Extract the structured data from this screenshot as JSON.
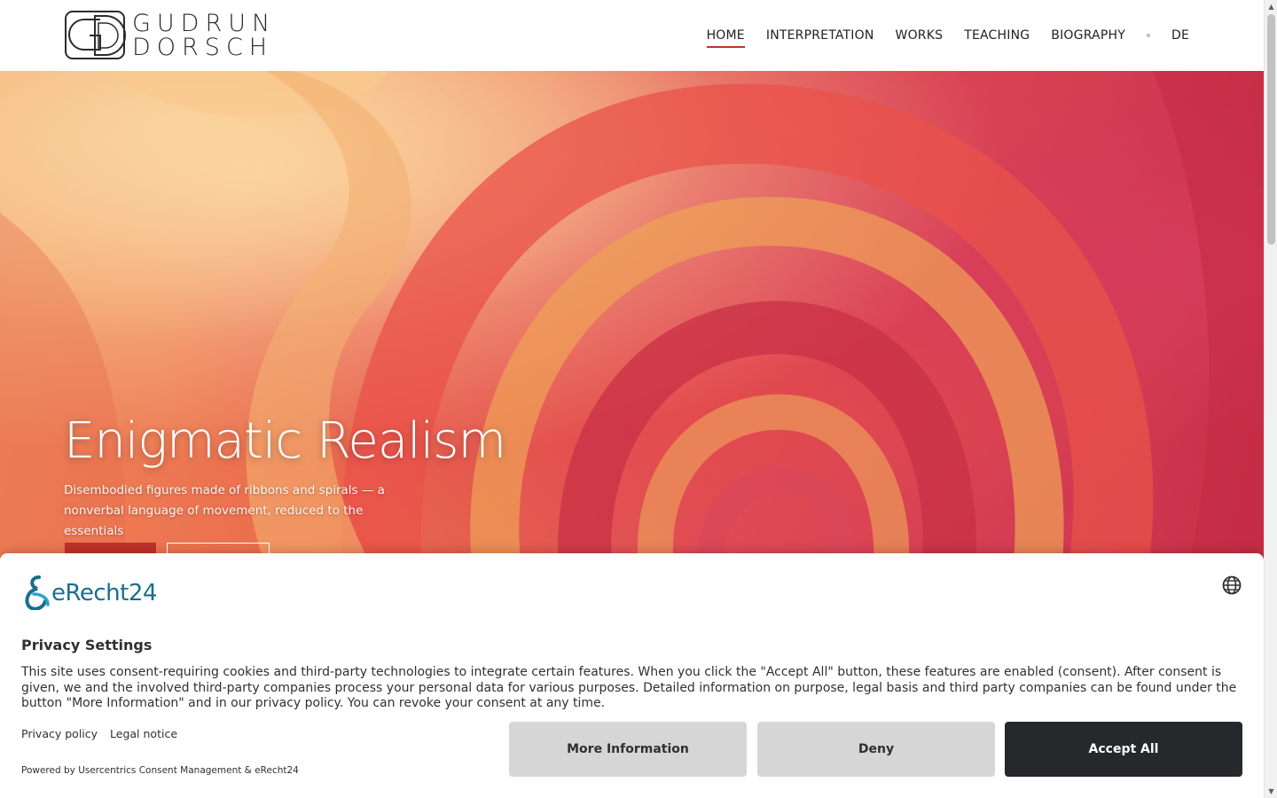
{
  "header": {
    "logo_line1": "GUDRUN",
    "logo_line2": "DORSCH",
    "nav": [
      {
        "label": "HOME",
        "active": true
      },
      {
        "label": "INTERPRETATION"
      },
      {
        "label": "WORKS"
      },
      {
        "label": "TEACHING"
      },
      {
        "label": "BIOGRAPHY"
      }
    ],
    "language": "DE",
    "accent_color": "#c2342a"
  },
  "hero": {
    "title": "Enigmatic Realism",
    "subtitle": "Disembodied figures made of ribbons and spirals — a nonverbal language of movement, reduced to the essentials"
  },
  "consent": {
    "brand": "eRecht24",
    "title": "Privacy Settings",
    "text": "This site uses consent-requiring cookies and third-party technologies to integrate certain features. When you click the \"Accept All\" button, these features are enabled (consent). After consent is given, we and the involved third-party companies process your personal data for various purposes. Detailed information on purpose, legal basis and third party companies can be found under the button \"More Information\" and in our privacy policy. You can revoke your consent at any time.",
    "links": {
      "privacy": "Privacy policy",
      "legal": "Legal notice"
    },
    "powered_by": "Powered by Usercentrics Consent Management & eRecht24",
    "buttons": {
      "more": "More Information",
      "deny": "Deny",
      "accept": "Accept All"
    },
    "icons": {
      "language": "globe-icon"
    }
  }
}
